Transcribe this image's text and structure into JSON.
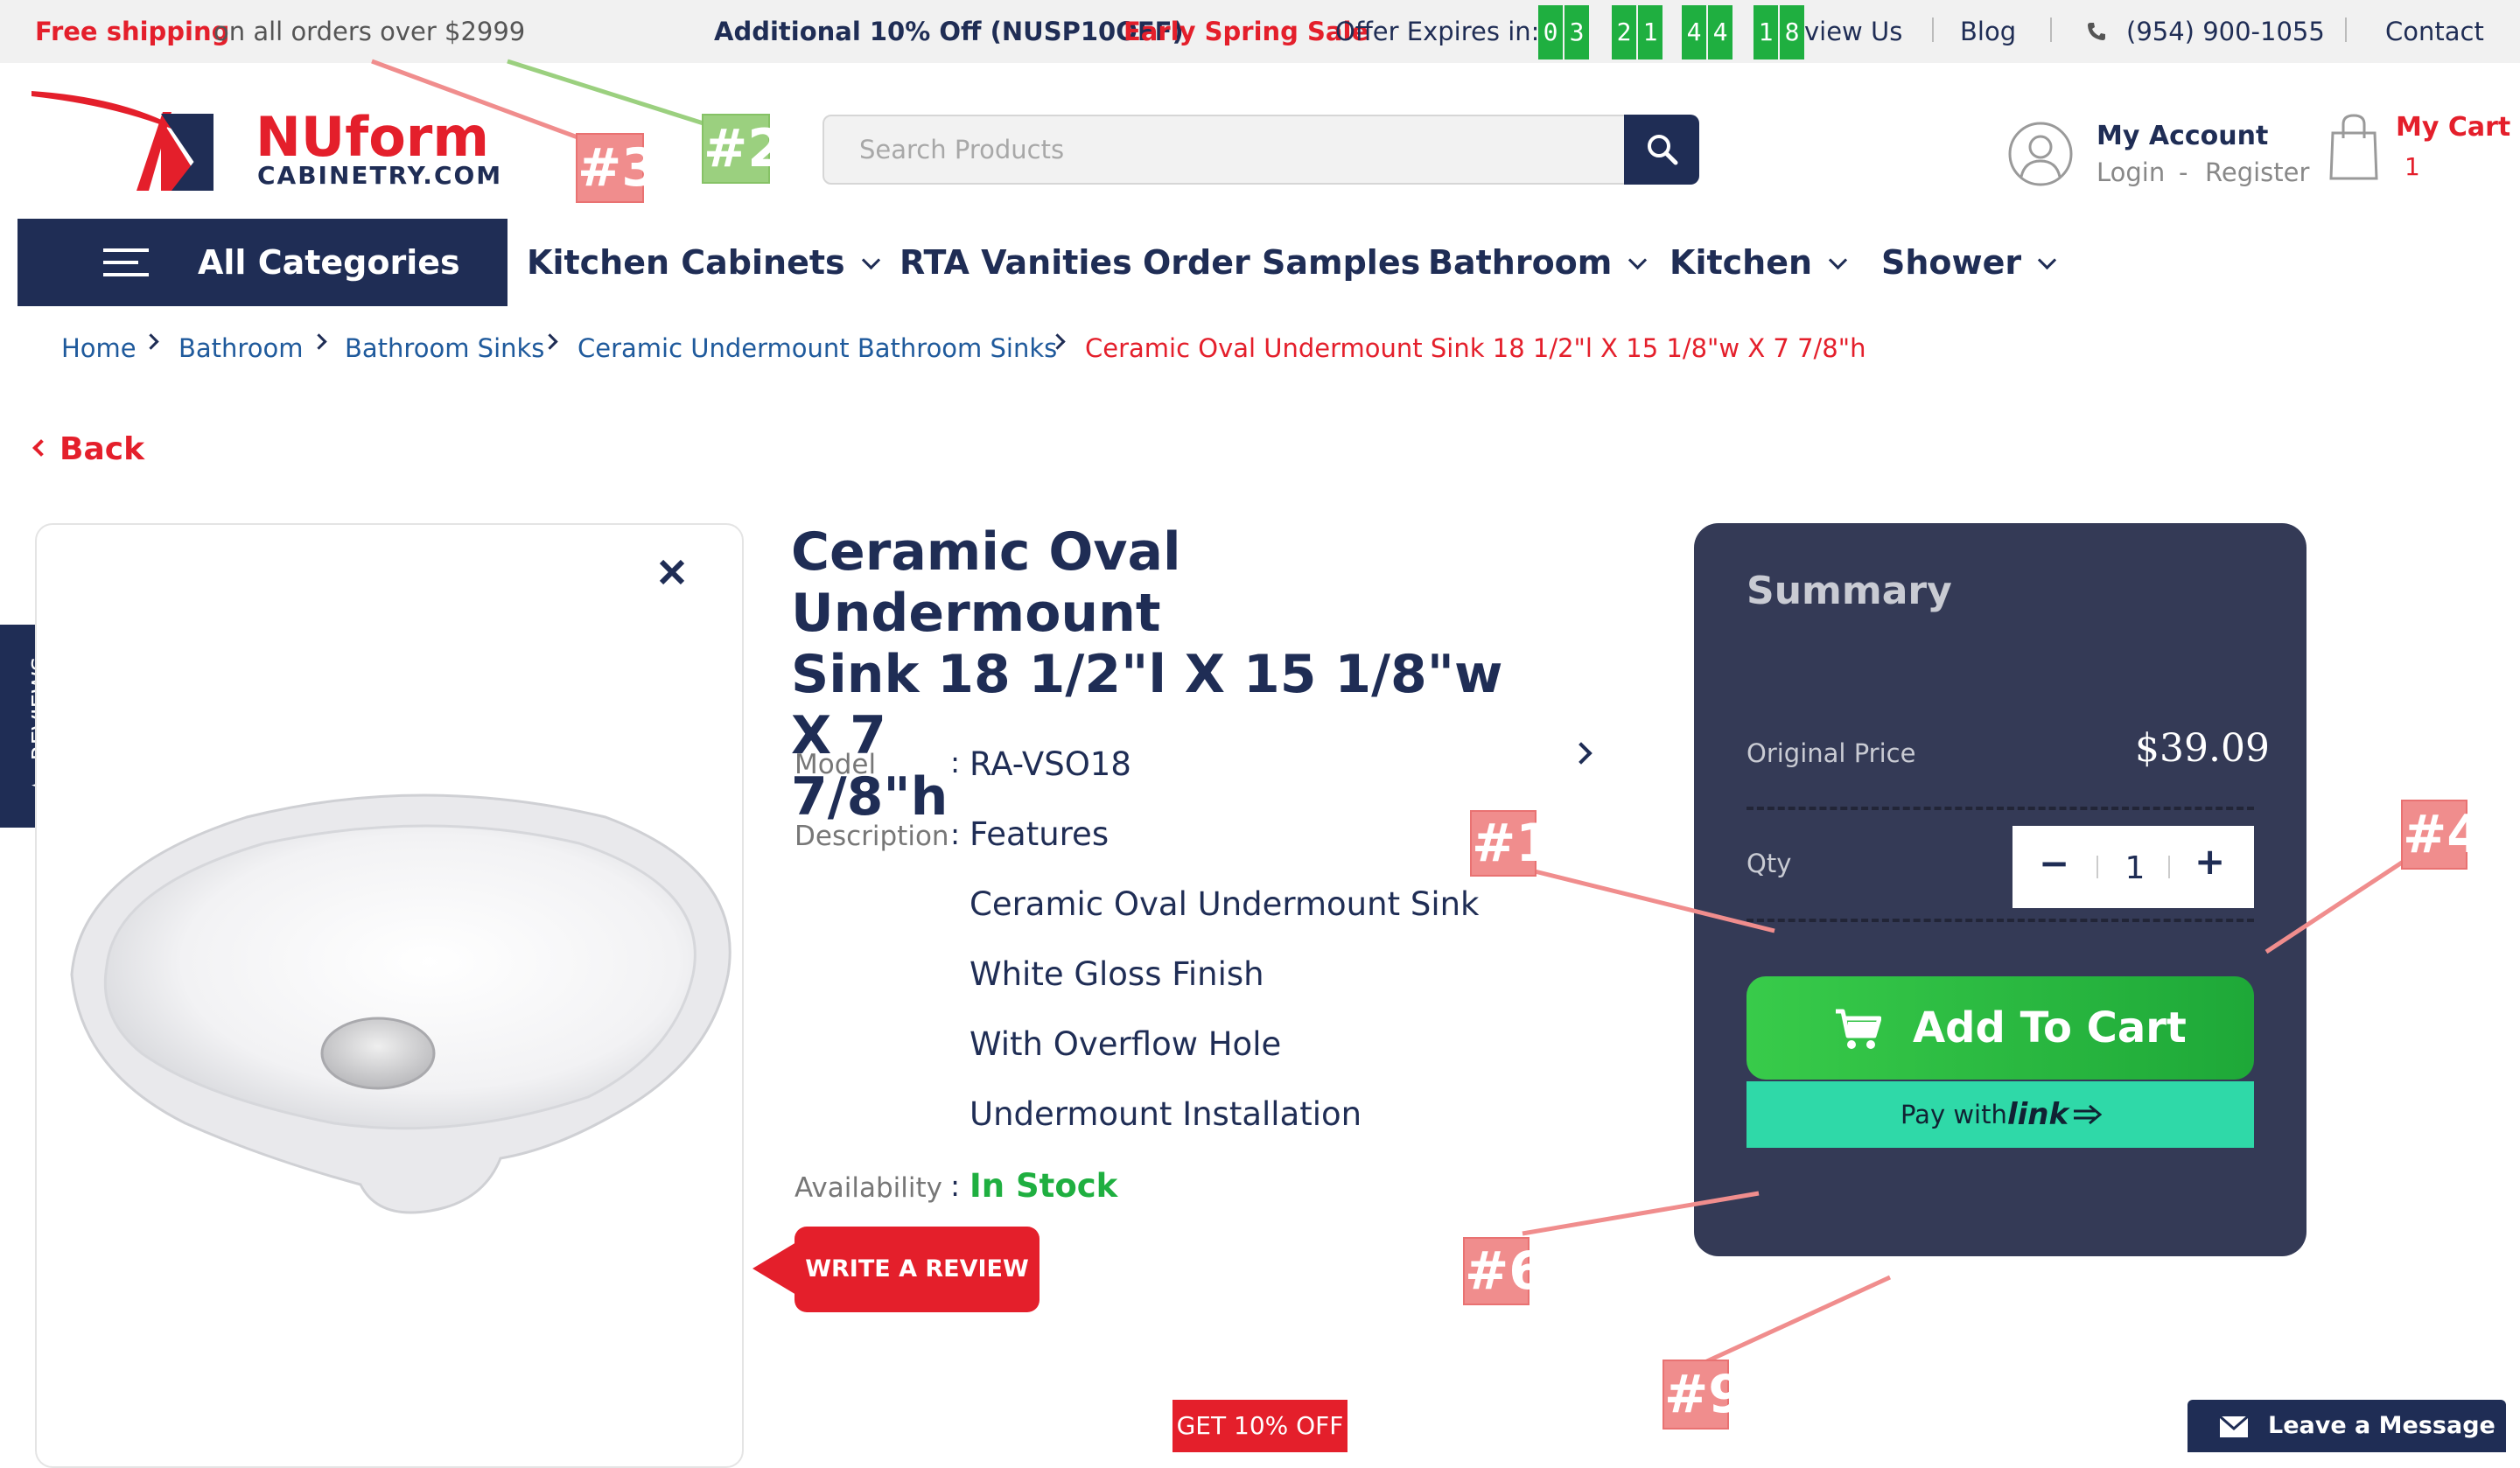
{
  "topbar": {
    "free_shipping": "Free shipping",
    "free_shipping_rest": "on all orders over $2999",
    "promo_prefix": "Additional 10% Off (NUSP10OFF)",
    "promo_sale": "Early Spring Sale",
    "promo_suffix": "Offer Expires in:",
    "countdown": [
      "0",
      "3",
      "2",
      "1",
      "4",
      "4",
      "1",
      "8"
    ],
    "links": {
      "reviews": "view Us",
      "blog": "Blog",
      "phone": "(954) 900-1055",
      "contact": "Contact"
    }
  },
  "logo": {
    "brand": "NUform",
    "sub": "CABINETRY.COM"
  },
  "search": {
    "placeholder": "Search Products"
  },
  "account": {
    "title": "My Account",
    "login": "Login",
    "dash": "-",
    "register": "Register"
  },
  "cart": {
    "title": "My Cart",
    "count": "1"
  },
  "nav": {
    "all_categories": "All Categories",
    "items": [
      "Kitchen Cabinets",
      "RTA Vanities",
      "Order Samples",
      "Bathroom",
      "Kitchen",
      "Shower"
    ]
  },
  "breadcrumb": [
    "Home",
    "Bathroom",
    "Bathroom Sinks",
    "Ceramic Undermount Bathroom Sinks",
    "Ceramic Oval Undermount Sink 18 1/2\"l X 15 1/8\"w X 7 7/8\"h"
  ],
  "back_label": "Back",
  "reviews_tab": "REVIEWS",
  "product": {
    "title_lines": [
      "Ceramic Oval Undermount",
      "Sink 18 1/2\"l X 15 1/8\"w X 7",
      "7/8\"h"
    ],
    "model_label": "Model",
    "model": "RA-VSO18",
    "description_label": "Description",
    "features_title": "Features",
    "features": [
      "Ceramic Oval Undermount Sink",
      "White Gloss Finish",
      "With Overflow Hole",
      "Undermount Installation"
    ],
    "availability_label": "Availability",
    "availability": "In Stock",
    "colon": ":"
  },
  "write_review": "WRITE A REVIEW",
  "summary": {
    "title": "Summary",
    "original_price_label": "Original Price",
    "original_price": "$39.09",
    "qty_label": "Qty",
    "qty": "1",
    "minus": "−",
    "plus": "+",
    "add_to_cart": "Add To Cart",
    "pay_with": "Pay with",
    "link": "link"
  },
  "get_off": "GET 10% OFF",
  "leave_message": "Leave a Message",
  "annotations": [
    "#1",
    "#2",
    "#3",
    "#4",
    "#6",
    "#9"
  ],
  "colors": {
    "navy": "#1f2d55",
    "red": "#e41f2b",
    "green": "#1faf40",
    "summary_bg": "#343a56",
    "badge": "#f08d8d"
  }
}
